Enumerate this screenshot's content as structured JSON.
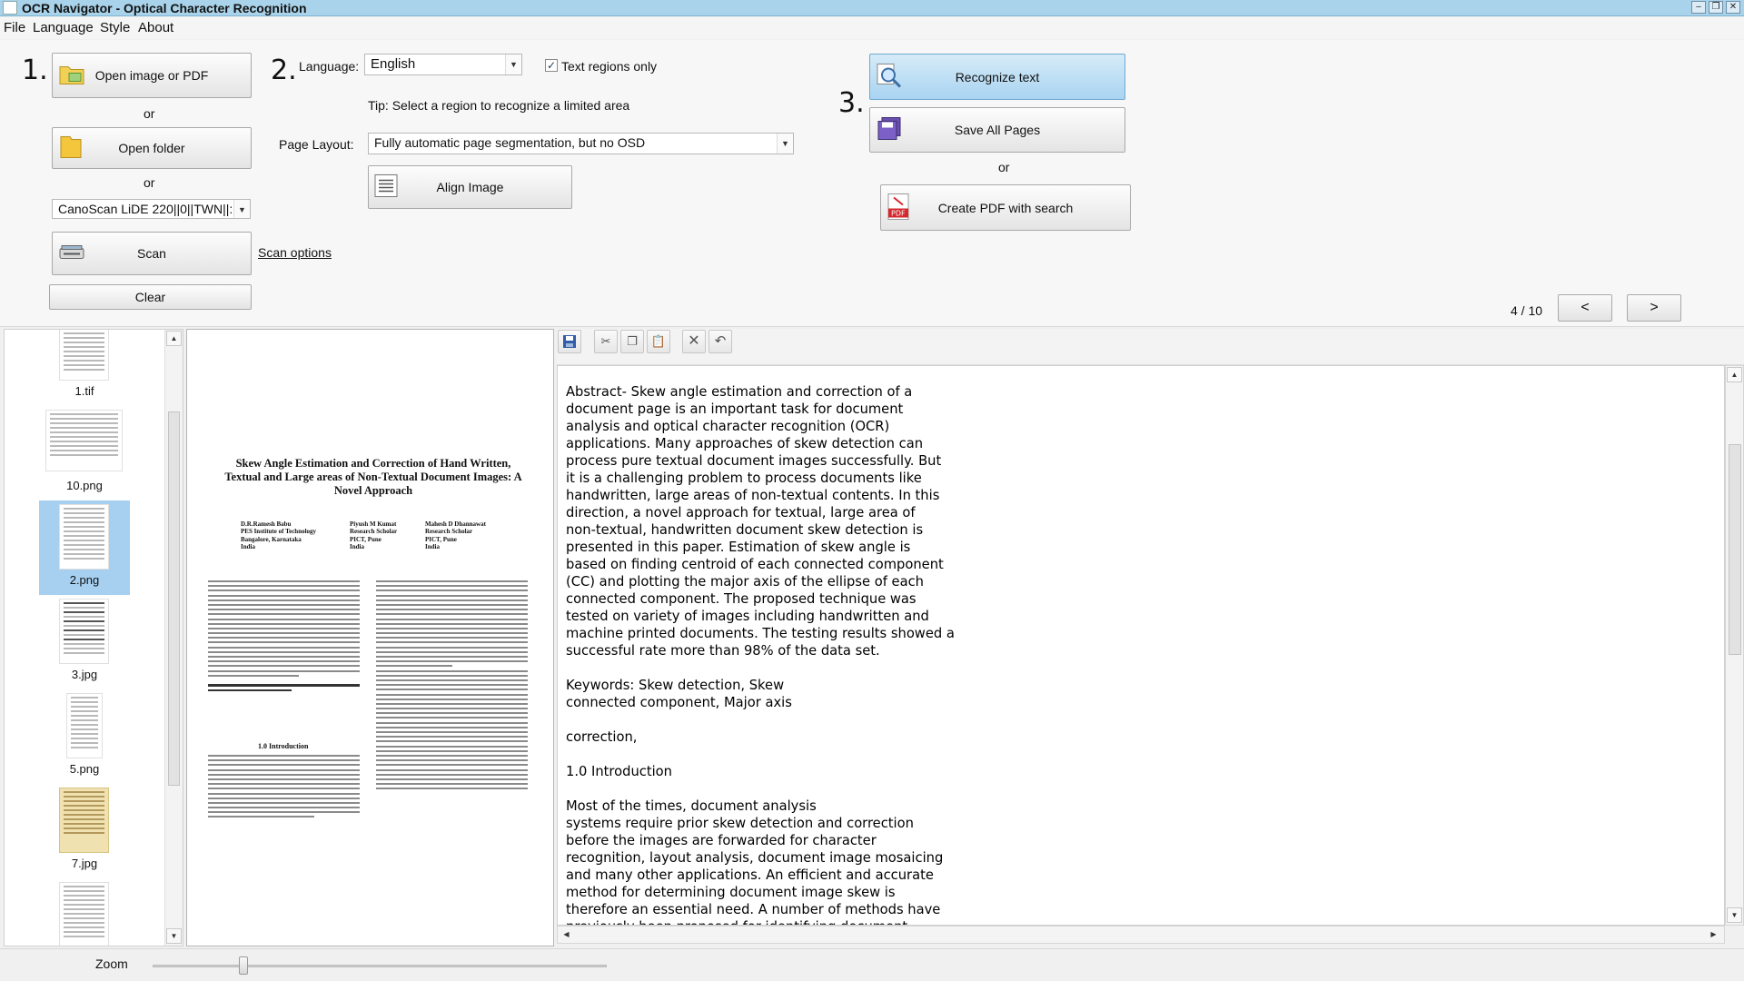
{
  "window": {
    "title": "OCR Navigator - Optical Character Recognition",
    "controls": [
      "–",
      "❐",
      "✕"
    ]
  },
  "menu": [
    "File",
    "Language",
    "Style",
    "About"
  ],
  "steps": [
    "1.",
    "2.",
    "3."
  ],
  "source": {
    "open_image_label": "Open image or PDF",
    "or1": "or",
    "open_folder_label": "Open folder",
    "or2": "or",
    "scanner_value": "CanoScan LiDE 220||0||TWN||:",
    "scan_label": "Scan",
    "scan_options_label": "Scan options",
    "clear_label": "Clear"
  },
  "settings": {
    "language_label": "Language:",
    "language_value": "English",
    "text_regions_label": "Text regions only",
    "text_regions_checked": true,
    "tip": "Tip: Select a region to recognize a limited area",
    "page_layout_label": "Page Layout:",
    "page_layout_value": "Fully automatic page segmentation, but no OSD",
    "align_label": "Align Image"
  },
  "actions": {
    "recognize_label": "Recognize text",
    "save_all_label": "Save All Pages",
    "or": "or",
    "create_pdf_label": "Create PDF with search"
  },
  "pager": {
    "current": 4,
    "total": 10,
    "text": "4 / 10",
    "prev_label": "<",
    "next_label": ">"
  },
  "thumbnails": [
    {
      "label": "1.tif",
      "selected": false
    },
    {
      "label": "10.png",
      "selected": false
    },
    {
      "label": "2.png",
      "selected": true
    },
    {
      "label": "3.jpg",
      "selected": false
    },
    {
      "label": "5.png",
      "selected": false
    },
    {
      "label": "7.jpg",
      "selected": false
    }
  ],
  "preview": {
    "title": "Skew Angle Estimation and Correction of Hand Written, Textual and Large areas of Non-Textual Document Images: A Novel Approach",
    "authors": [
      "D.R.Ramesh Babu\nPES Institute of Technology\nBangalore, Karnataka\nIndia",
      "Piyush M Kumat\nResearch Scholar\nPICT, Pune\nIndia",
      "Mahesh D Dhannawat\nResearch Scholar\nPICT, Pune\nIndia"
    ],
    "section_heading": "1.0 Introduction"
  },
  "toolbar": {
    "save_icon": "save-icon",
    "cut_icon": "cut-icon",
    "copy_icon": "copy-icon",
    "paste_icon": "paste-icon",
    "clear_icon": "clear-icon",
    "undo_icon": "undo-icon"
  },
  "ocr_text": "Abstract- Skew angle estimation and correction of a\ndocument page is an important task for document\nanalysis and optical character recognition (OCR)\napplications. Many approaches of skew detection can\nprocess pure textual document images successfully. But\nit is a challenging problem to process documents like\nhandwritten, large areas of non-textual contents. In this\ndirection, a novel approach for textual, large area of\nnon-textual, handwritten document skew detection is\npresented in this paper. Estimation of skew angle is\nbased on finding centroid of each connected component\n(CC) and plotting the major axis of the ellipse of each\nconnected component. The proposed technique was\ntested on variety of images including handwritten and\nmachine printed documents. The testing results showed a\nsuccessful rate more than 98% of the data set.\n\nKeywords: Skew detection, Skew\nconnected component, Major axis\n\ncorrection,\n\n1.0 Introduction\n\nMost of the times, document analysis\nsystems require prior skew detection and correction\nbefore the images are forwarded for character\nrecognition, layout analysis, document image mosaicing\nand many other applications. An efficient and accurate\nmethod for determining document image skew is\ntherefore an essential need. A number of methods have\npreviously been proposed for identifying document",
  "zoom": {
    "label": "Zoom",
    "value_fraction": 0.2
  }
}
